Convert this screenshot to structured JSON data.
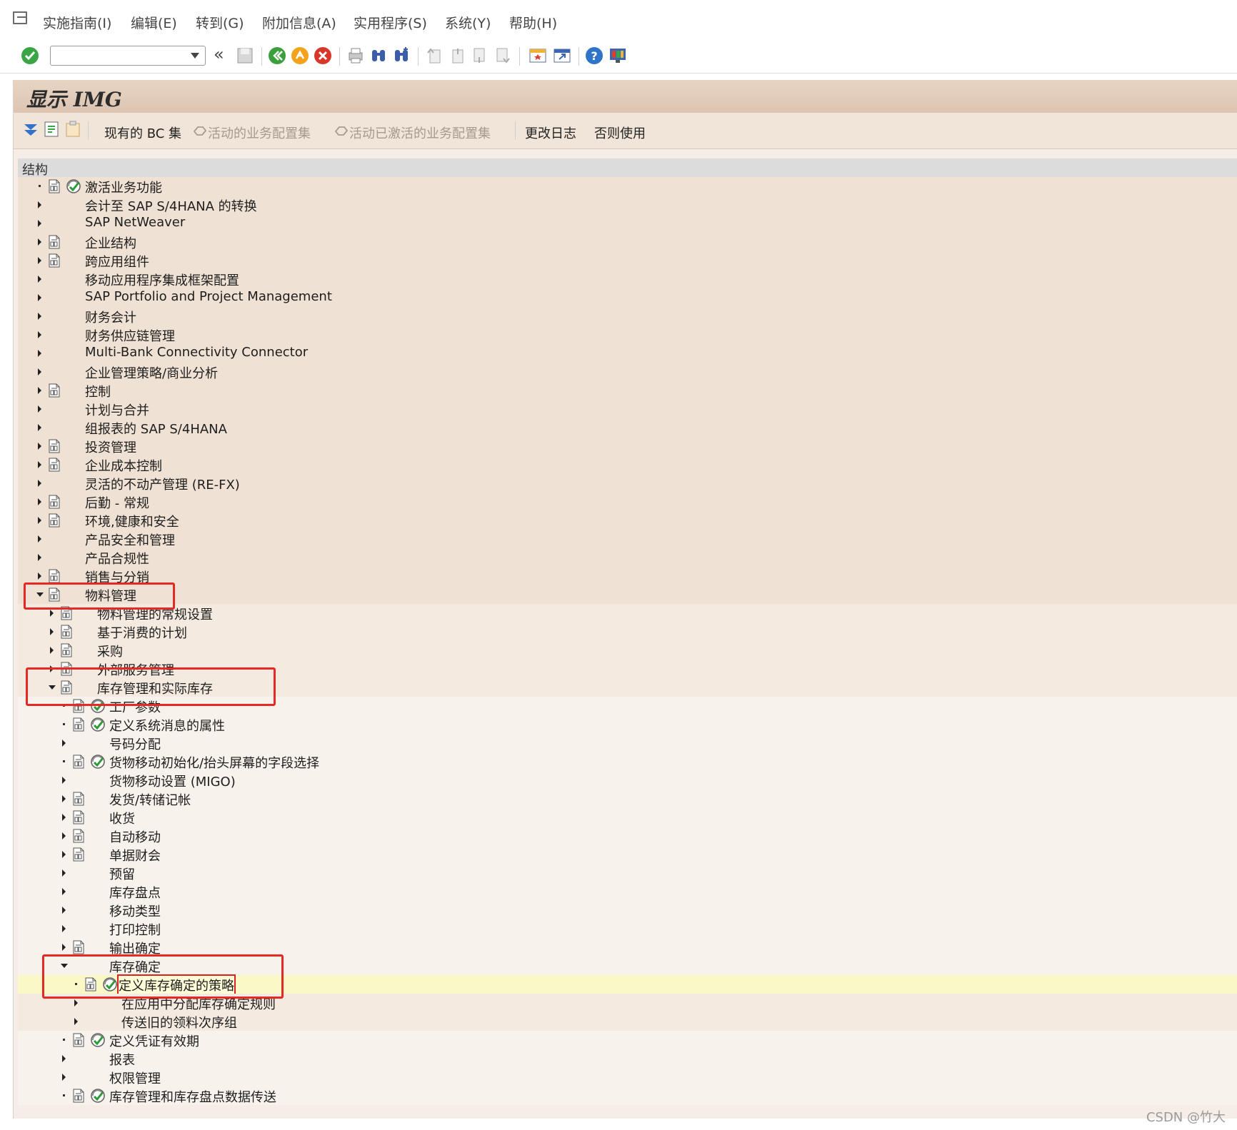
{
  "menu": {
    "items": [
      "实施指南(I)",
      "编辑(E)",
      "转到(G)",
      "附加信息(A)",
      "实用程序(S)",
      "系统(Y)",
      "帮助(H)"
    ]
  },
  "toolbar": {
    "command_value": "",
    "chevron": "«"
  },
  "page": {
    "title": "显示 IMG"
  },
  "app_toolbar": {
    "bc_sets": "现有的 BC 集",
    "active_bc_sets": "活动的业务配置集",
    "activated_bc_sets": "活动已激活的业务配置集",
    "change_log": "更改日志",
    "otherwise_use": "否则使用"
  },
  "tree": {
    "header": "结构",
    "rows": [
      {
        "label": "激活业务功能",
        "level": 0,
        "node": "leaf",
        "doc": true,
        "exec": true
      },
      {
        "label": "会计至 SAP S/4HANA 的转换",
        "level": 0,
        "node": "collapsed",
        "doc": false,
        "exec": false
      },
      {
        "label": "SAP NetWeaver",
        "level": 0,
        "node": "collapsed",
        "doc": false,
        "exec": false
      },
      {
        "label": "企业结构",
        "level": 0,
        "node": "collapsed",
        "doc": true,
        "exec": false
      },
      {
        "label": "跨应用组件",
        "level": 0,
        "node": "collapsed",
        "doc": true,
        "exec": false
      },
      {
        "label": "移动应用程序集成框架配置",
        "level": 0,
        "node": "collapsed",
        "doc": false,
        "exec": false
      },
      {
        "label": "SAP Portfolio and Project Management",
        "level": 0,
        "node": "collapsed",
        "doc": false,
        "exec": false
      },
      {
        "label": "财务会计",
        "level": 0,
        "node": "collapsed",
        "doc": false,
        "exec": false
      },
      {
        "label": "财务供应链管理",
        "level": 0,
        "node": "collapsed",
        "doc": false,
        "exec": false
      },
      {
        "label": "Multi-Bank Connectivity Connector",
        "level": 0,
        "node": "collapsed",
        "doc": false,
        "exec": false
      },
      {
        "label": "企业管理策略/商业分析",
        "level": 0,
        "node": "collapsed",
        "doc": false,
        "exec": false
      },
      {
        "label": "控制",
        "level": 0,
        "node": "collapsed",
        "doc": true,
        "exec": false
      },
      {
        "label": "计划与合并",
        "level": 0,
        "node": "collapsed",
        "doc": false,
        "exec": false
      },
      {
        "label": "组报表的 SAP S/4HANA",
        "level": 0,
        "node": "collapsed",
        "doc": false,
        "exec": false
      },
      {
        "label": "投资管理",
        "level": 0,
        "node": "collapsed",
        "doc": true,
        "exec": false
      },
      {
        "label": "企业成本控制",
        "level": 0,
        "node": "collapsed",
        "doc": true,
        "exec": false
      },
      {
        "label": "灵活的不动产管理 (RE-FX)",
        "level": 0,
        "node": "collapsed",
        "doc": false,
        "exec": false
      },
      {
        "label": "后勤 - 常规",
        "level": 0,
        "node": "collapsed",
        "doc": true,
        "exec": false
      },
      {
        "label": "环境,健康和安全",
        "level": 0,
        "node": "collapsed",
        "doc": true,
        "exec": false
      },
      {
        "label": "产品安全和管理",
        "level": 0,
        "node": "collapsed",
        "doc": false,
        "exec": false
      },
      {
        "label": "产品合规性",
        "level": 0,
        "node": "collapsed",
        "doc": false,
        "exec": false
      },
      {
        "label": "销售与分销",
        "level": 0,
        "node": "collapsed",
        "doc": true,
        "exec": false
      },
      {
        "label": "物料管理",
        "level": 0,
        "node": "expanded",
        "doc": true,
        "exec": false
      },
      {
        "label": "物料管理的常规设置",
        "level": 1,
        "node": "collapsed",
        "doc": true,
        "exec": false
      },
      {
        "label": "基于消费的计划",
        "level": 1,
        "node": "collapsed",
        "doc": true,
        "exec": false
      },
      {
        "label": "采购",
        "level": 1,
        "node": "collapsed",
        "doc": true,
        "exec": false
      },
      {
        "label": "外部服务管理",
        "level": 1,
        "node": "collapsed",
        "doc": true,
        "exec": false
      },
      {
        "label": "库存管理和实际库存",
        "level": 1,
        "node": "expanded",
        "doc": true,
        "exec": false
      },
      {
        "label": "工厂参数",
        "level": 2,
        "node": "leaf",
        "doc": true,
        "exec": true
      },
      {
        "label": "定义系统消息的属性",
        "level": 2,
        "node": "leaf",
        "doc": true,
        "exec": true
      },
      {
        "label": "号码分配",
        "level": 2,
        "node": "collapsed",
        "doc": false,
        "exec": false
      },
      {
        "label": "货物移动初始化/抬头屏幕的字段选择",
        "level": 2,
        "node": "leaf",
        "doc": true,
        "exec": true
      },
      {
        "label": "货物移动设置 (MIGO)",
        "level": 2,
        "node": "collapsed",
        "doc": false,
        "exec": false
      },
      {
        "label": "发货/转储记帐",
        "level": 2,
        "node": "collapsed",
        "doc": true,
        "exec": false
      },
      {
        "label": "收货",
        "level": 2,
        "node": "collapsed",
        "doc": true,
        "exec": false
      },
      {
        "label": "自动移动",
        "level": 2,
        "node": "collapsed",
        "doc": true,
        "exec": false
      },
      {
        "label": "单据财会",
        "level": 2,
        "node": "collapsed",
        "doc": true,
        "exec": false
      },
      {
        "label": "预留",
        "level": 2,
        "node": "collapsed",
        "doc": false,
        "exec": false
      },
      {
        "label": "库存盘点",
        "level": 2,
        "node": "collapsed",
        "doc": false,
        "exec": false
      },
      {
        "label": "移动类型",
        "level": 2,
        "node": "collapsed",
        "doc": false,
        "exec": false
      },
      {
        "label": "打印控制",
        "level": 2,
        "node": "collapsed",
        "doc": false,
        "exec": false
      },
      {
        "label": "输出确定",
        "level": 2,
        "node": "collapsed",
        "doc": true,
        "exec": false
      },
      {
        "label": "库存确定",
        "level": 2,
        "node": "expanded",
        "doc": false,
        "exec": false
      },
      {
        "label": "定义库存确定的策略",
        "level": 3,
        "node": "leaf",
        "doc": true,
        "exec": true,
        "selected": true
      },
      {
        "label": "在应用中分配库存确定规则",
        "level": 3,
        "node": "collapsed",
        "doc": false,
        "exec": false
      },
      {
        "label": "传送旧的领料次序组",
        "level": 3,
        "node": "collapsed",
        "doc": false,
        "exec": false
      },
      {
        "label": "定义凭证有效期",
        "level": 2,
        "node": "leaf",
        "doc": true,
        "exec": true
      },
      {
        "label": "报表",
        "level": 2,
        "node": "collapsed",
        "doc": false,
        "exec": false
      },
      {
        "label": "权限管理",
        "level": 2,
        "node": "collapsed",
        "doc": false,
        "exec": false
      },
      {
        "label": "库存管理和库存盘点数据传送",
        "level": 2,
        "node": "leaf",
        "doc": true,
        "exec": true
      }
    ]
  },
  "watermark": "CSDN @竹大",
  "colors": {
    "highlight_red": "#e52a26",
    "selected_row": "#fbf8c8",
    "panel_bg": "#f5ede6"
  }
}
